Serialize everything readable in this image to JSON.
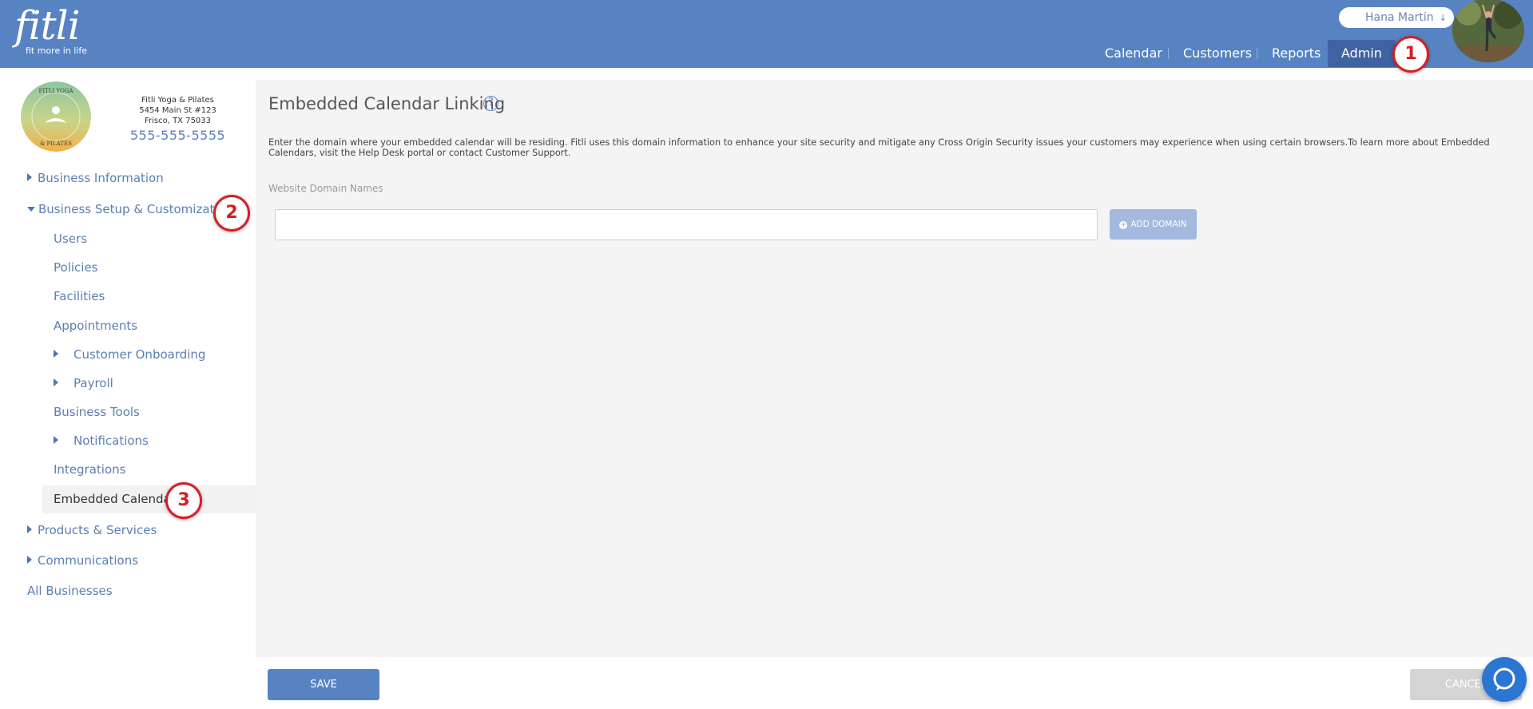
{
  "header": {
    "logo_text": "fitli",
    "logo_tagline": "fit more in life",
    "user_name": "Hana Martin",
    "user_menu_icon": "chevron-double-down-icon",
    "nav": [
      {
        "label": "Calendar"
      },
      {
        "label": "Customers"
      },
      {
        "label": "Reports"
      },
      {
        "label": "Admin",
        "active": true
      }
    ]
  },
  "markers": [
    "1",
    "2",
    "3"
  ],
  "business": {
    "name": "Fitli Yoga & Pilates",
    "address1": "5454 Main St #123",
    "address2": "Frisco, TX 75033",
    "phone": "555-555-5555",
    "logo_text": "FITLI YOGA & PILATES"
  },
  "sidebar": {
    "business_information": "Business Information",
    "business_setup": "Business Setup & Customization",
    "sub_items": {
      "users": "Users",
      "policies": "Policies",
      "facilities": "Facilities",
      "appointments": "Appointments",
      "customer_onboarding": "Customer Onboarding",
      "payroll": "Payroll",
      "business_tools": "Business Tools",
      "notifications": "Notifications",
      "integrations": "Integrations",
      "embedded_calendar": "Embedded Calendar"
    },
    "products_services": "Products & Services",
    "communications": "Communications",
    "all_businesses": "All Businesses"
  },
  "main": {
    "title": "Embedded Calendar Linking",
    "help_glyph": "?",
    "description": "Enter the domain where your embedded calendar will be residing. Fitli uses this domain information to enhance your site security and mitigate any Cross Origin Security issues your customers may experience when using certain browsers.To learn more about Embedded Calendars, visit the Help Desk portal or contact Customer Support.",
    "field_label": "Website Domain Names",
    "domain_value": "",
    "add_domain_label": "ADD DOMAIN"
  },
  "footer": {
    "save_label": "SAVE",
    "cancel_label": "CANCEL"
  },
  "colors": {
    "header": "#5783c3",
    "active_nav": "#3f62a3",
    "link": "#5b7fb3",
    "marker": "#d51f25",
    "chat": "#2a76d2"
  }
}
